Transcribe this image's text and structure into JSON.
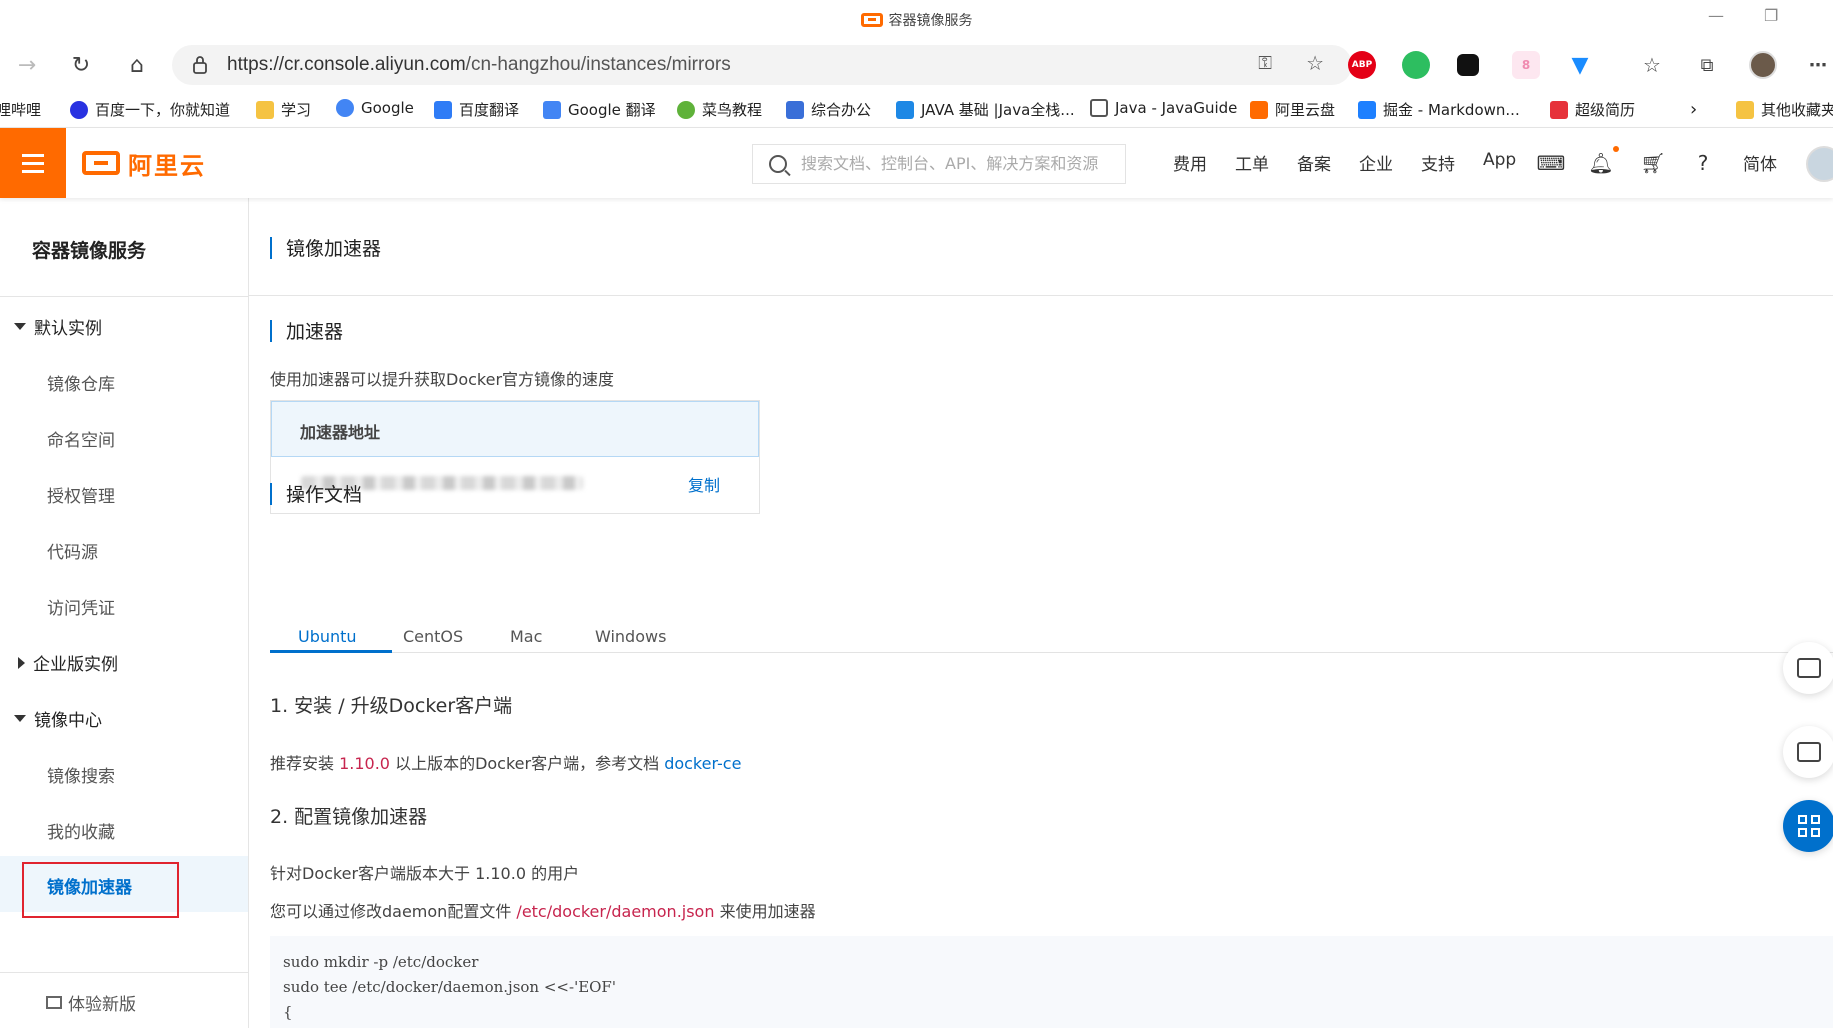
{
  "browser": {
    "window_title": "容器镜像服务",
    "url_host": "https://cr.console.aliyun.com",
    "url_path": "/cn-hangzhou/instances/mirrors",
    "extensions": [
      {
        "name": "adblock-plus-icon",
        "label": "ABP",
        "color": "#e40016"
      },
      {
        "name": "evernote-icon",
        "label": "",
        "color": "#2dbe60"
      },
      {
        "name": "extension-icon",
        "label": "",
        "color": "#111111"
      },
      {
        "name": "cat-extension-icon",
        "label": "8",
        "color": "#f08bb0"
      },
      {
        "name": "vpn-extension-icon",
        "label": "",
        "color": "#1a8cff"
      }
    ]
  },
  "bookmarks": [
    {
      "label": "哩哔哩",
      "icon": "bilibili-icon",
      "color": "#fb7299"
    },
    {
      "label": "百度一下，你就知道",
      "icon": "baidu-icon",
      "color": "#2932e1"
    },
    {
      "label": "学习",
      "icon": "folder-icon",
      "color": "#f5c342"
    },
    {
      "label": "Google",
      "icon": "google-icon",
      "color": "#4285f4"
    },
    {
      "label": "百度翻译",
      "icon": "baidu-translate-icon",
      "color": "#2f7cf6"
    },
    {
      "label": "Google 翻译",
      "icon": "google-translate-icon",
      "color": "#4285f4"
    },
    {
      "label": "菜鸟教程",
      "icon": "runoob-icon",
      "color": "#5fb23a"
    },
    {
      "label": "综合办公",
      "icon": "office-icon",
      "color": "#3a6fd8"
    },
    {
      "label": "JAVA 基础 |Java全栈...",
      "icon": "java-icon",
      "color": "#1e88e5"
    },
    {
      "label": "Java - JavaGuide",
      "icon": "page-icon",
      "color": "#555555"
    },
    {
      "label": "阿里云盘",
      "icon": "aliyun-drive-icon",
      "color": "#ff6a00"
    },
    {
      "label": "掘金 - Markdown...",
      "icon": "juejin-icon",
      "color": "#1e80ff"
    },
    {
      "label": "超级简历",
      "icon": "resume-icon",
      "color": "#e6323a"
    },
    {
      "label": "其他收藏夹",
      "icon": "folder-icon",
      "color": "#f5c342"
    }
  ],
  "header": {
    "brand": "阿里云",
    "search_placeholder": "搜索文档、控制台、API、解决方案和资源",
    "nav": [
      "费用",
      "工单",
      "备案",
      "企业",
      "支持",
      "App"
    ],
    "lang": "简体"
  },
  "sidebar": {
    "title": "容器镜像服务",
    "groups": [
      {
        "label": "默认实例",
        "expanded": true,
        "items": [
          "镜像仓库",
          "命名空间",
          "授权管理",
          "代码源",
          "访问凭证"
        ]
      },
      {
        "label": "企业版实例",
        "expanded": false,
        "items": []
      },
      {
        "label": "镜像中心",
        "expanded": true,
        "items": [
          "镜像搜索",
          "我的收藏",
          "镜像加速器"
        ]
      }
    ],
    "active": "镜像加速器",
    "bottom": "体验新版"
  },
  "main": {
    "page_title": "镜像加速器",
    "section_accelerator": "加速器",
    "description": "使用加速器可以提升获取Docker官方镜像的速度",
    "box_header": "加速器地址",
    "copy_label": "复制",
    "section_docs": "操作文档",
    "tabs": [
      "Ubuntu",
      "CentOS",
      "Mac",
      "Windows"
    ],
    "active_tab": "Ubuntu",
    "step1_title": "1. 安装 / 升级Docker客户端",
    "step1_pre": "推荐安装 ",
    "step1_version": "1.10.0",
    "step1_mid": " 以上版本的Docker客户端，参考文档 ",
    "step1_link": "docker-ce",
    "step2_title": "2. 配置镜像加速器",
    "step2_line1": "针对Docker客户端版本大于 1.10.0 的用户",
    "step2_line2_pre": "您可以通过修改daemon配置文件 ",
    "step2_path": "/etc/docker/daemon.json",
    "step2_line2_post": " 来使用加速器",
    "code_lines": [
      "sudo mkdir -p /etc/docker",
      "sudo tee /etc/docker/daemon.json <<-'EOF'",
      "{"
    ]
  },
  "colors": {
    "brand_orange": "#ff6a00",
    "link_blue": "#0070cc",
    "highlight_red": "#c7254e",
    "annotation_red": "#e0242f"
  }
}
